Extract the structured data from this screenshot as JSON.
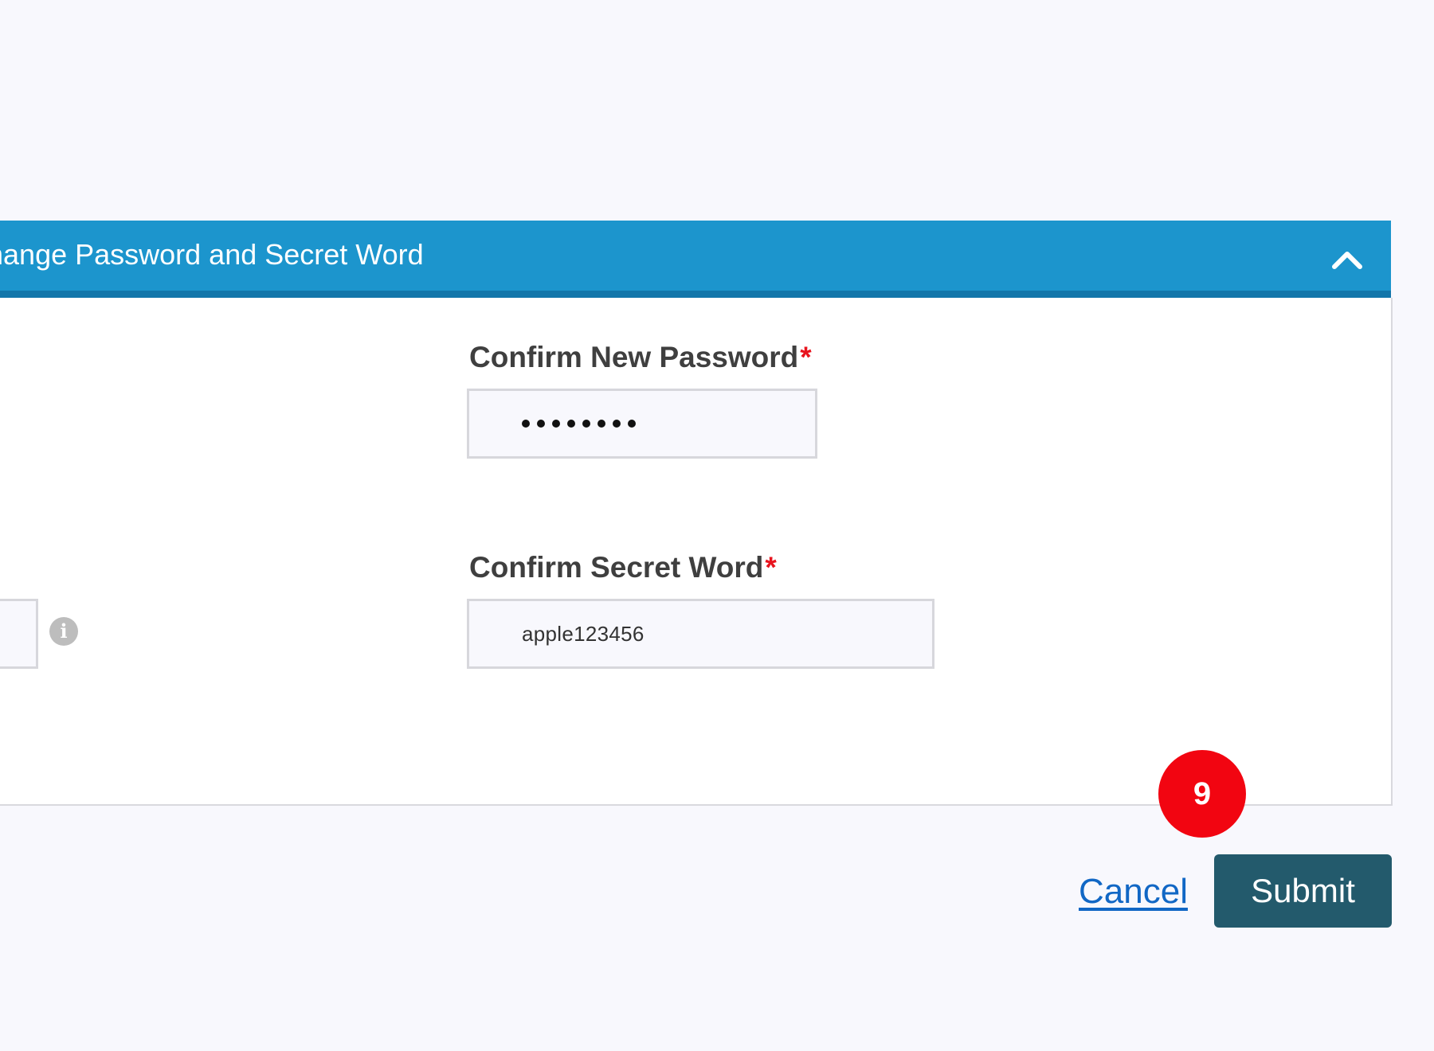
{
  "panel": {
    "title": "Change Password and Secret Word",
    "collapse_icon": "chevron-up-icon",
    "header_color": "#1c95cd"
  },
  "confirm_password": {
    "label": "Confirm New Password",
    "required_marker": "*",
    "value_masked": "••••••••",
    "masked_length": 8
  },
  "confirm_secret": {
    "label": "Confirm Secret Word",
    "required_marker": "*",
    "value": "apple123456"
  },
  "left_field": {
    "info_icon": "info-icon"
  },
  "step_badge": {
    "number": "9",
    "color": "#f20511"
  },
  "actions": {
    "cancel_label": "Cancel",
    "submit_label": "Submit",
    "submit_color": "#235a6c"
  }
}
